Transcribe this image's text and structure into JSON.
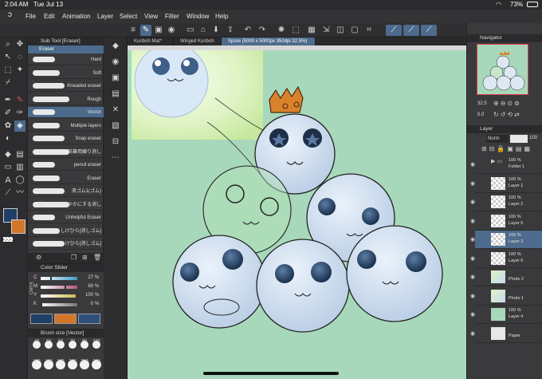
{
  "status": {
    "time": "2:04 AM",
    "date": "Tue Jul 13",
    "battery": "73%"
  },
  "menu": [
    "File",
    "Edit",
    "Animation",
    "Layer",
    "Select",
    "View",
    "Filter",
    "Window",
    "Help"
  ],
  "subtool": {
    "header": "Sub Tool [Eraser]",
    "group": "Eraser",
    "items": [
      {
        "label": "Hard",
        "selected": false
      },
      {
        "label": "Soft",
        "selected": false
      },
      {
        "label": "Kneaded eraser",
        "selected": false
      },
      {
        "label": "Rough",
        "selected": false
      },
      {
        "label": "Vector",
        "selected": true
      },
      {
        "label": "Multiple layers",
        "selected": false
      },
      {
        "label": "Snap eraser",
        "selected": false
      },
      {
        "label": "鉛筆用練り消し",
        "selected": false
      },
      {
        "label": "pencil eraser",
        "selected": false
      },
      {
        "label": "Eraser",
        "selected": false
      },
      {
        "label": "消ゴム1(ゴム)",
        "selected": false
      },
      {
        "label": "紙ベタをにきやかにする消し",
        "selected": false
      },
      {
        "label": "Unhelpful Eraser",
        "selected": false
      },
      {
        "label": "しけひら[消しゴム]",
        "selected": false
      },
      {
        "label": "しけひら[消しゴム]",
        "selected": false
      }
    ]
  },
  "color_slider": {
    "header": "Color Slider",
    "mode": "CMYK",
    "rows": [
      {
        "ch": "C",
        "value": "27",
        "unit": "%",
        "fill": 0.27,
        "color": "#3f9fc4"
      },
      {
        "ch": "M",
        "value": "69",
        "unit": "%",
        "fill": 0.69,
        "color": "#b0577a"
      },
      {
        "ch": "Y",
        "value": "100",
        "unit": "%",
        "fill": 1.0,
        "color": "#c8b84a"
      },
      {
        "ch": "K",
        "value": "0",
        "unit": "%",
        "fill": 0.0,
        "color": "#777"
      }
    ],
    "main_color": "#1f3f66",
    "sub_color": "#d4762a"
  },
  "brush_size": {
    "header": "Brush size [Vector]",
    "sizes": [
      "40",
      "50",
      "60",
      "70",
      "80",
      "100",
      "120",
      "150",
      "170",
      "200",
      "250",
      "300"
    ]
  },
  "tabs": [
    {
      "label": "Kuriboh Mat*",
      "active": false
    },
    {
      "label": "Winged Kuriboh",
      "active": false
    },
    {
      "label": "Spore (5000 x 5000px 350dpi 32.5%)",
      "active": true
    }
  ],
  "navigator": {
    "header": "Navigator",
    "zoom": "32.5",
    "angle": "0.0"
  },
  "layer_panel": {
    "header": "Layer",
    "blend": "Norm",
    "opacity": "100",
    "layers": [
      {
        "pct": "100 %",
        "name": "Folder 1",
        "kind": "folder",
        "selected": false
      },
      {
        "pct": "100 %",
        "name": "Layer 1",
        "kind": "raster",
        "selected": false
      },
      {
        "pct": "100 %",
        "name": "Layer 2",
        "kind": "raster",
        "selected": false
      },
      {
        "pct": "100 %",
        "name": "Layer 5",
        "kind": "raster",
        "selected": false
      },
      {
        "pct": "100 %",
        "name": "Layer 3",
        "kind": "vector",
        "selected": true
      },
      {
        "pct": "100 %",
        "name": "Layer 6",
        "kind": "raster",
        "selected": false
      },
      {
        "pct": "",
        "name": "Photo 2",
        "kind": "photo",
        "selected": false
      },
      {
        "pct": "",
        "name": "Photo 1",
        "kind": "photo",
        "selected": false
      },
      {
        "pct": "100 %",
        "name": "Layer 4",
        "kind": "fill",
        "selected": false
      },
      {
        "pct": "",
        "name": "Paper",
        "kind": "paper",
        "selected": false
      }
    ]
  },
  "colors": {
    "accent": "#4d6b8c",
    "canvas_bg": "#a8d8bb",
    "panel": "#3a3a3c"
  }
}
